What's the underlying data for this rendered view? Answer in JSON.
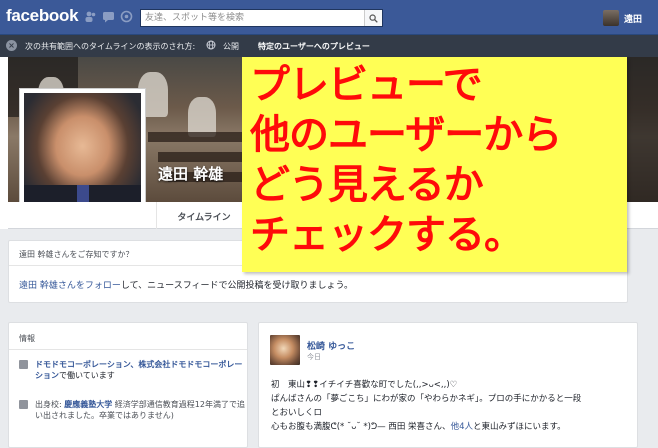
{
  "header": {
    "logo": "facebook",
    "search_placeholder": "友達、スポット等を検索",
    "user_name": "遠田",
    "icons": [
      "friend-requests-icon",
      "messages-icon",
      "notifications-icon",
      "search-icon"
    ]
  },
  "preview_bar": {
    "close": "×",
    "description": "次の共有範囲へのタイムラインの表示のされ方:",
    "public": "公開",
    "specific": "特定のユーザーへのプレビュー"
  },
  "profile": {
    "name": "遠田 幹雄",
    "tab_timeline": "タイムライン"
  },
  "know_card": {
    "title": "遠田 幹雄さんをご存知ですか？",
    "follow_link": "遠田 幹雄さんをフォロー",
    "follow_text": "して、ニュースフィードで公開投稿を受け取りましょう。"
  },
  "info_card": {
    "title": "情報",
    "work_link": "ドモドモコーポレーション、株式会社ドモドモコーポレーション",
    "work_suffix": "で働いています",
    "school_prefix": "出身校:",
    "school_link": "慶應義塾大学",
    "school_text": "経済学部通信教育過程12年満了で追い出されました。卒業ではありません)"
  },
  "post": {
    "author": "松崎 ゆっこ",
    "time": "今日",
    "lines": [
      "初　東山❢❢イチイチ喜歡な町でした(,,>ᴗ<,,)♡",
      "ぱんばさんの「夢ごこち」にわが家の「やわらかネギ」。プロの手にかかると一段",
      "とおいしくロ",
      "心もお腹も満腹ᕦ(* ˘ᴗ˘ *)ᕤ"
    ],
    "tag_prefix": "— 西田 栄喜さん、",
    "tag_link": "他4人",
    "tag_suffix": "と東山みずほにいます。"
  },
  "callout": {
    "lines": [
      "プレビューで",
      "他のユーザーから",
      "どう見えるか",
      "チェックする。"
    ],
    "text_color": "#ff0a0a",
    "bg_color": "#ffff55"
  },
  "colors": {
    "brand": "#3b5998",
    "link": "#365899",
    "preview_bar": "#333b48"
  }
}
